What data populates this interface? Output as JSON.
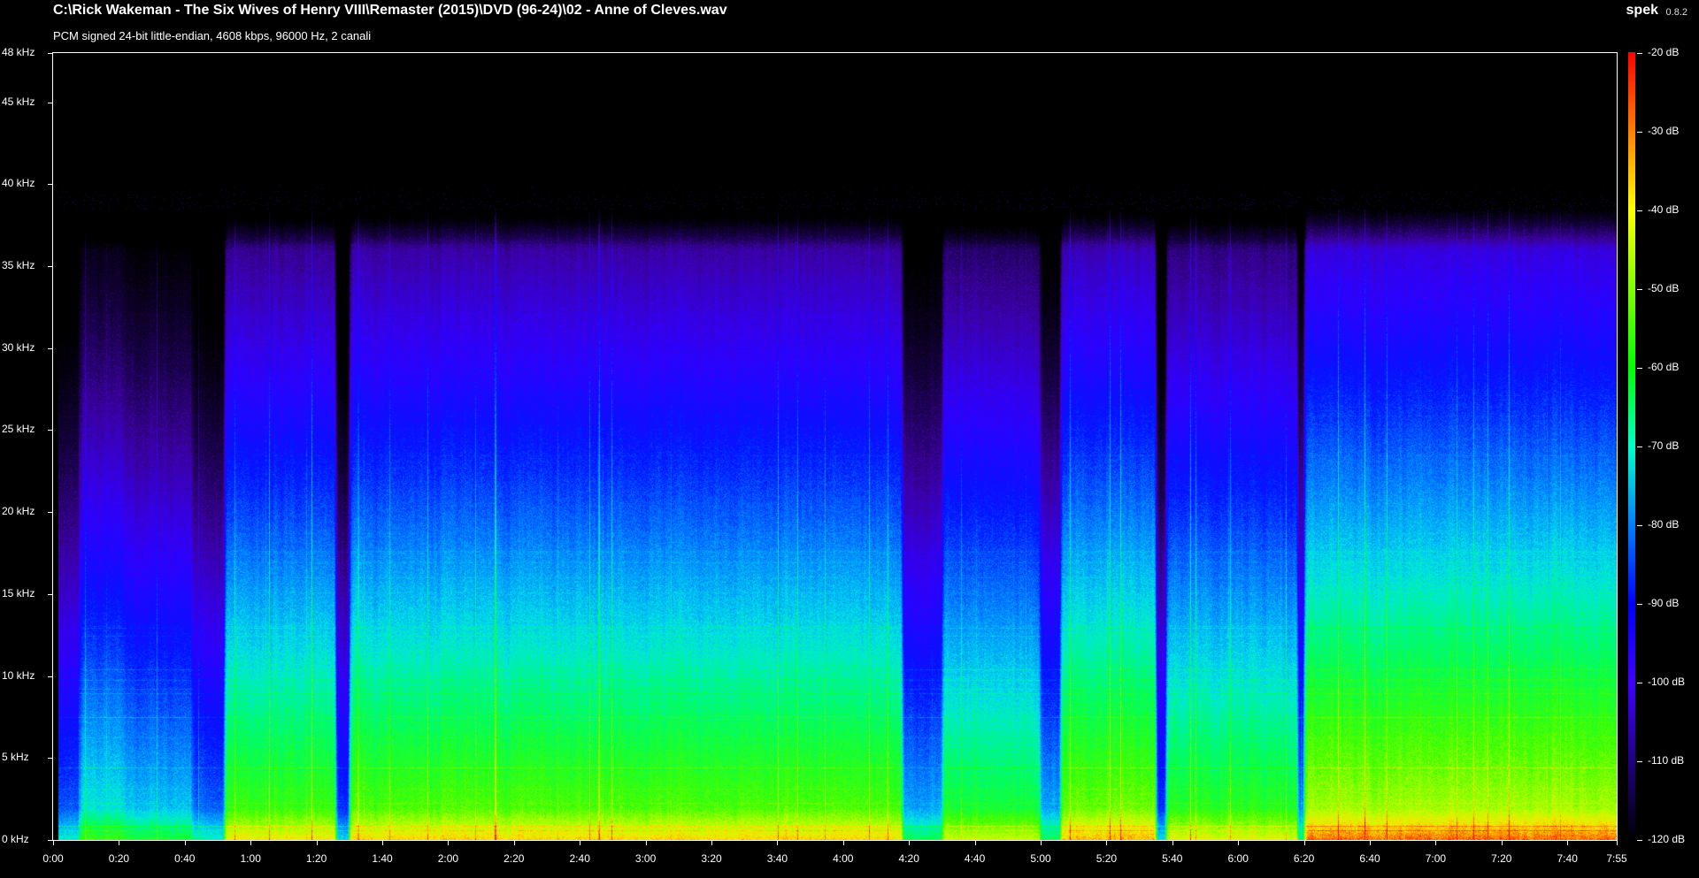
{
  "window": {
    "title": "C:\\Rick Wakeman - The Six Wives of Henry VIII\\Remaster (2015)\\DVD (96-24)\\02 - Anne of Cleves.wav",
    "subtitle": "PCM signed 24-bit little-endian, 4608 kbps, 96000 Hz, 2 canali",
    "app_name": "spek",
    "app_version": "0.8.2"
  },
  "axes": {
    "y_labels": [
      "48 kHz",
      "45 kHz",
      "40 kHz",
      "35 kHz",
      "30 kHz",
      "25 kHz",
      "20 kHz",
      "15 kHz",
      "10 kHz",
      "5 kHz",
      "0 kHz"
    ],
    "y_values": [
      48,
      45,
      40,
      35,
      30,
      25,
      20,
      15,
      10,
      5,
      0
    ],
    "y_max": 48,
    "x_labels": [
      "0:00",
      "0:20",
      "0:40",
      "1:00",
      "1:20",
      "1:40",
      "2:00",
      "2:20",
      "2:40",
      "3:00",
      "3:20",
      "3:40",
      "4:00",
      "4:20",
      "4:40",
      "5:00",
      "5:20",
      "5:40",
      "6:00",
      "6:20",
      "6:40",
      "7:00",
      "7:20",
      "7:40",
      "7:55"
    ],
    "x_values": [
      0,
      20,
      40,
      60,
      80,
      100,
      120,
      140,
      160,
      180,
      200,
      220,
      240,
      260,
      280,
      300,
      320,
      340,
      360,
      380,
      400,
      420,
      440,
      460,
      475
    ],
    "x_max_seconds": 475,
    "db_labels": [
      "-20 dB",
      "-30 dB",
      "-40 dB",
      "-50 dB",
      "-60 dB",
      "-70 dB",
      "-80 dB",
      "-90 dB",
      "-100 dB",
      "-110 dB",
      "-120 dB"
    ],
    "db_values": [
      -20,
      -30,
      -40,
      -50,
      -60,
      -70,
      -80,
      -90,
      -100,
      -110,
      -120
    ],
    "db_range": [
      -120,
      -20
    ]
  },
  "colors": {
    "background": "#000000",
    "text": "#ffffff",
    "legend_gradient": [
      "#ff0000",
      "#ff8000",
      "#ffff00",
      "#80ff00",
      "#00ff00",
      "#00ffcc",
      "#0080ff",
      "#0000ff",
      "#4000ff",
      "#200080",
      "#000000"
    ]
  }
}
